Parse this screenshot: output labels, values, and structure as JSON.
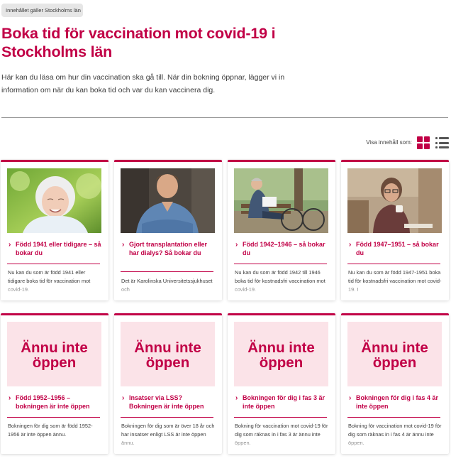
{
  "region_tag": "Innehållet gäller Stockholms län",
  "title": "Boka tid för vaccination mot covid-19 i Stockholms län",
  "intro": "Här kan du läsa om hur din vaccination ska gå till. När din bokning öppnar, lägger vi in information om när du kan boka tid och var du kan vaccinera dig.",
  "view_toggle": {
    "label": "Visa innehåll som:",
    "active": "grid",
    "grid_icon": "grid-icon",
    "list_icon": "list-icon",
    "accent": "#c10046"
  },
  "not_open_text": {
    "line1": "Ännu inte",
    "line2": "öppen"
  },
  "cards": [
    {
      "image": "elderly-woman-photo",
      "link": "Född 1941 eller tidigare – så bokar du",
      "desc": "Nu kan du som är född 1941 eller tidigare boka tid för vaccination mot covid-19."
    },
    {
      "image": "man-in-denim-shirt-photo",
      "link": "Gjort transplantation eller har dialys? Så bokar du",
      "desc": "Det är Karolinska Universitetssjukhuset och"
    },
    {
      "image": "elderly-man-on-bench-photo",
      "link": "Född 1942–1946 – så bokar du",
      "desc": "Nu kan du som är född 1942 till 1946 boka tid för kostnadsfri vaccination mot covid-19."
    },
    {
      "image": "woman-with-coffee-photo",
      "link": "Född 1947–1951 – så bokar du",
      "desc": "Nu kan du som är född 1947-1951 boka tid för kostnadsfri vaccination mot covid-19. I"
    },
    {
      "link": "Född 1952–1956 – bokningen är inte öppen",
      "desc": "Bokningen för dig som är född 1952-1956 är inte öppen ännu."
    },
    {
      "link": "Insatser via LSS? Bokningen är inte öppen",
      "desc": "Bokningen för dig som är över 18 år och har insatser enligt LSS är inte öppen ännu."
    },
    {
      "link": "Bokningen för dig i fas 3 är inte öppen",
      "desc": "Bokning för vaccination mot covid-19 för dig som räknas in i fas 3 är ännu inte öppen."
    },
    {
      "link": "Bokningen för dig i fas 4 är inte öppen",
      "desc": "Bokning för vaccination mot covid-19 för dig som räknas in i fas 4 är ännu inte öppen."
    }
  ]
}
